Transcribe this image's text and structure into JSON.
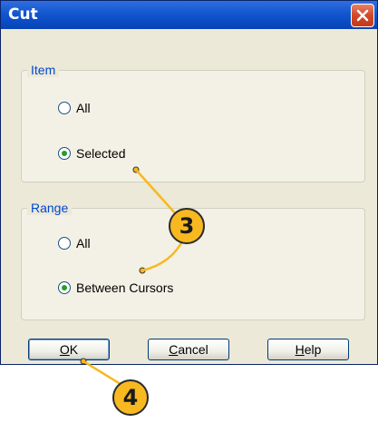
{
  "dialog": {
    "title": "Cut",
    "item_group": {
      "label": "Item",
      "options": [
        "All",
        "Selected"
      ],
      "selected": "Selected"
    },
    "range_group": {
      "label": "Range",
      "options": [
        "All",
        "Between Cursors"
      ],
      "selected": "Between Cursors"
    },
    "buttons": {
      "ok": {
        "accel": "O",
        "rest": "K"
      },
      "cancel": {
        "accel": "C",
        "rest": "ancel"
      },
      "help": {
        "accel": "H",
        "rest": "elp"
      }
    }
  },
  "callouts": {
    "three": "3",
    "four": "4"
  },
  "colors": {
    "titlebar": "#0A4DC6",
    "callout": "#F8B820",
    "leader_line": "#F8B820",
    "radio_dot": "#21A121"
  },
  "icons": {
    "close": "close-x-icon",
    "radio": "radio-button"
  }
}
